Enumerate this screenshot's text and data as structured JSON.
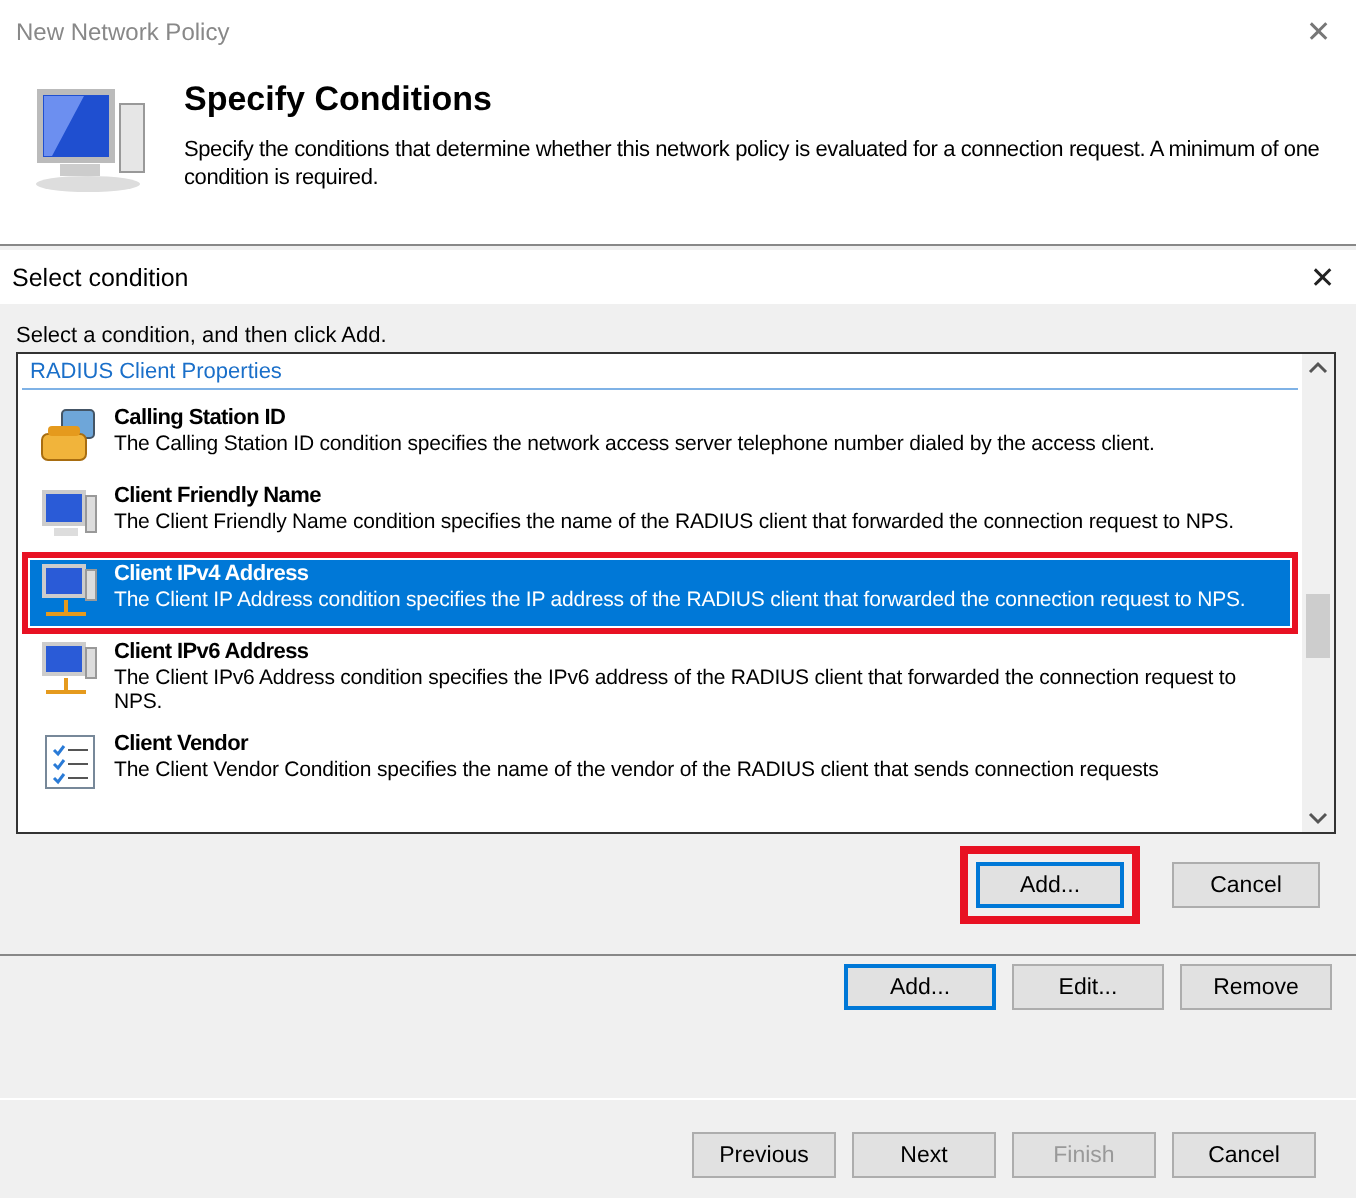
{
  "window": {
    "title": "New Network Policy",
    "close": "✕"
  },
  "header": {
    "title": "Specify Conditions",
    "description": "Specify the conditions that determine whether this network policy is evaluated for a connection request. A minimum of one condition is required."
  },
  "dialog": {
    "title": "Select condition",
    "close": "✕",
    "instruction": "Select a condition, and then click Add.",
    "group": "RADIUS Client Properties",
    "conditions": [
      {
        "kind": "phone",
        "name": "Calling Station ID",
        "description": "The Calling Station ID condition specifies the network access server telephone number dialed by the access client.",
        "selected": false,
        "highlighted": false
      },
      {
        "kind": "monitor",
        "name": "Client Friendly Name",
        "description": "The Client Friendly Name condition specifies the name of the RADIUS client that forwarded the connection request to NPS.",
        "selected": false,
        "highlighted": false
      },
      {
        "kind": "network",
        "name": "Client IPv4 Address",
        "description": "The Client IP Address condition specifies the IP address of the RADIUS client that forwarded the connection request to NPS.",
        "selected": true,
        "highlighted": true
      },
      {
        "kind": "network",
        "name": "Client IPv6 Address",
        "description": "The Client IPv6 Address condition specifies the IPv6 address of the RADIUS client that forwarded the connection request to NPS.",
        "selected": false,
        "highlighted": false
      },
      {
        "kind": "checklist",
        "name": "Client Vendor",
        "description": "The Client Vendor Condition specifies the name of the vendor of the RADIUS client that sends connection requests",
        "selected": false,
        "highlighted": false
      }
    ],
    "buttons": [
      {
        "label": "Add...",
        "default": true,
        "highlighted": true
      },
      {
        "label": "Cancel",
        "default": false,
        "highlighted": false
      }
    ]
  },
  "condition_buttons": [
    {
      "label": "Add...",
      "default": true,
      "disabled": false
    },
    {
      "label": "Edit...",
      "default": false,
      "disabled": false
    },
    {
      "label": "Remove",
      "default": false,
      "disabled": false
    }
  ],
  "footer_buttons": [
    {
      "label": "Previous",
      "disabled": false
    },
    {
      "label": "Next",
      "disabled": false
    },
    {
      "label": "Finish",
      "disabled": true
    },
    {
      "label": "Cancel",
      "disabled": false
    }
  ]
}
